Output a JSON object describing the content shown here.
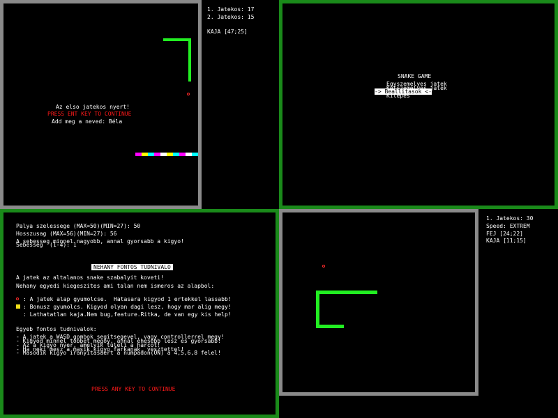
{
  "q1": {
    "scores": [
      "1. Jatekos: 17",
      "2. Jatekos: 15"
    ],
    "food": "KAJA [47;25]",
    "winner": "Az elso jatekos nyert!",
    "press": "PRESS ENT KEY TO CONTINUE",
    "name_prompt": "Add meg a neved: Béla",
    "colors": {
      "border": "#8a8a8a",
      "snake": "#22ee22",
      "food": "#ff2a2a"
    },
    "icons": [
      "snake-segment-icon",
      "food-dot-icon",
      "rainbow-snake-icon"
    ]
  },
  "q2": {
    "title": "SNAKE GAME",
    "menu": [
      "Egyszemelyes jatek",
      "Ketszemelyes jatek",
      "-> Beallitasok <-",
      "Kilepes"
    ],
    "selected_index": 2,
    "colors": {
      "border": "#1a8a1a"
    }
  },
  "q3": {
    "settings": [
      "Palya szelessege (MAX=50)(MIN=27): 50",
      "Hosszusag (MAX=56)(MIN=27): 56",
      "A sebesseg minnel nagyobb, annal gyorsabb a kigyo!",
      "Sebesseg  (1-4): 1"
    ],
    "heading": "NEHANY FONTOS TUDNIVALO",
    "intro": [
      "A jatek az altalanos snake szabalyit koveti!",
      "Nehany egyedi kiegeszites ami talan nem ismeros az alapbol:"
    ],
    "items": [
      ": A jatek alap gyumolcse.  Hatasara kigyod 1 ertekkel lassabb!",
      ": Bonusz gyumolcs. Kigyod olyan dagi lesz, hogy mar alig megy!",
      ": Lathatatlan kaja.Nem bug,feature.Ritka, de van egy kis help!"
    ],
    "other_title": "Egyeb fontos tudnivalok:",
    "other": [
      "- A jatek a WASD gombok segitsegevel, vagy controllerrel megy!",
      "- Kigyod minnel tobbet megoy, annal ehesebb lesz es gyorsabb!",
      "- Az a kigyo nyer, amelyik tuleli a harcot!",
      "- Ha neki mesz a masik kigyo farkanak, vesztettel!",
      "- Masodik kigyo iranyitasaert a numpadon(ON) a 4,5,6,8 felel!"
    ],
    "press": "PRESS ANY KEY TO CONTINUE",
    "icons": [
      "red-fruit-icon",
      "yellow-bonus-icon"
    ]
  },
  "q4": {
    "score": "1. Jatekos: 30",
    "speed": "Speed: EXTREM",
    "head": "FEJ [24;22]",
    "food": "KAJA [11;15]"
  }
}
